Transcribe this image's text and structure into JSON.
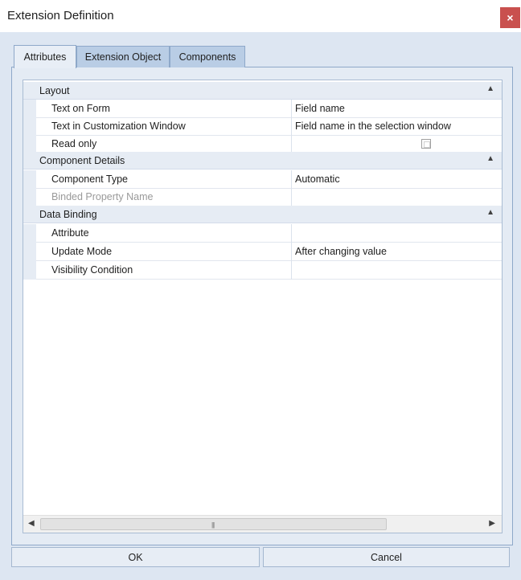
{
  "window": {
    "title": "Extension Definition",
    "close_glyph": "×"
  },
  "tabs": [
    {
      "label": "Attributes",
      "active": true
    },
    {
      "label": "Extension Object",
      "active": false
    },
    {
      "label": "Components",
      "active": false
    }
  ],
  "categories": [
    {
      "label": "Layout",
      "chevron": "▲",
      "rows": [
        {
          "name": "Text on Form",
          "value": "Field name"
        },
        {
          "name": "Text in Customization Window",
          "value": "Field name in the selection window"
        },
        {
          "name": "Read only",
          "value": "",
          "checkbox": false
        }
      ]
    },
    {
      "label": "Component Details",
      "chevron": "▲",
      "rows": [
        {
          "name": "Component Type",
          "value": "Automatic"
        },
        {
          "name": "Binded Property Name",
          "value": "",
          "disabled": true
        }
      ]
    },
    {
      "label": "Data Binding",
      "chevron": "▲",
      "rows": [
        {
          "name": "Attribute",
          "value": ""
        },
        {
          "name": "Update Mode",
          "value": "After changing value"
        },
        {
          "name": "Visibility Condition",
          "value": ""
        }
      ]
    }
  ],
  "scrollbar": {
    "left_arrow": "◀",
    "right_arrow": "▶",
    "grip": "|||"
  },
  "buttons": {
    "ok": "OK",
    "cancel": "Cancel"
  },
  "colors": {
    "dialog_background": "#dde6f2",
    "close_button": "#c9504e",
    "tab_inactive": "#b9cde5",
    "category_row": "#e6ecf4"
  }
}
